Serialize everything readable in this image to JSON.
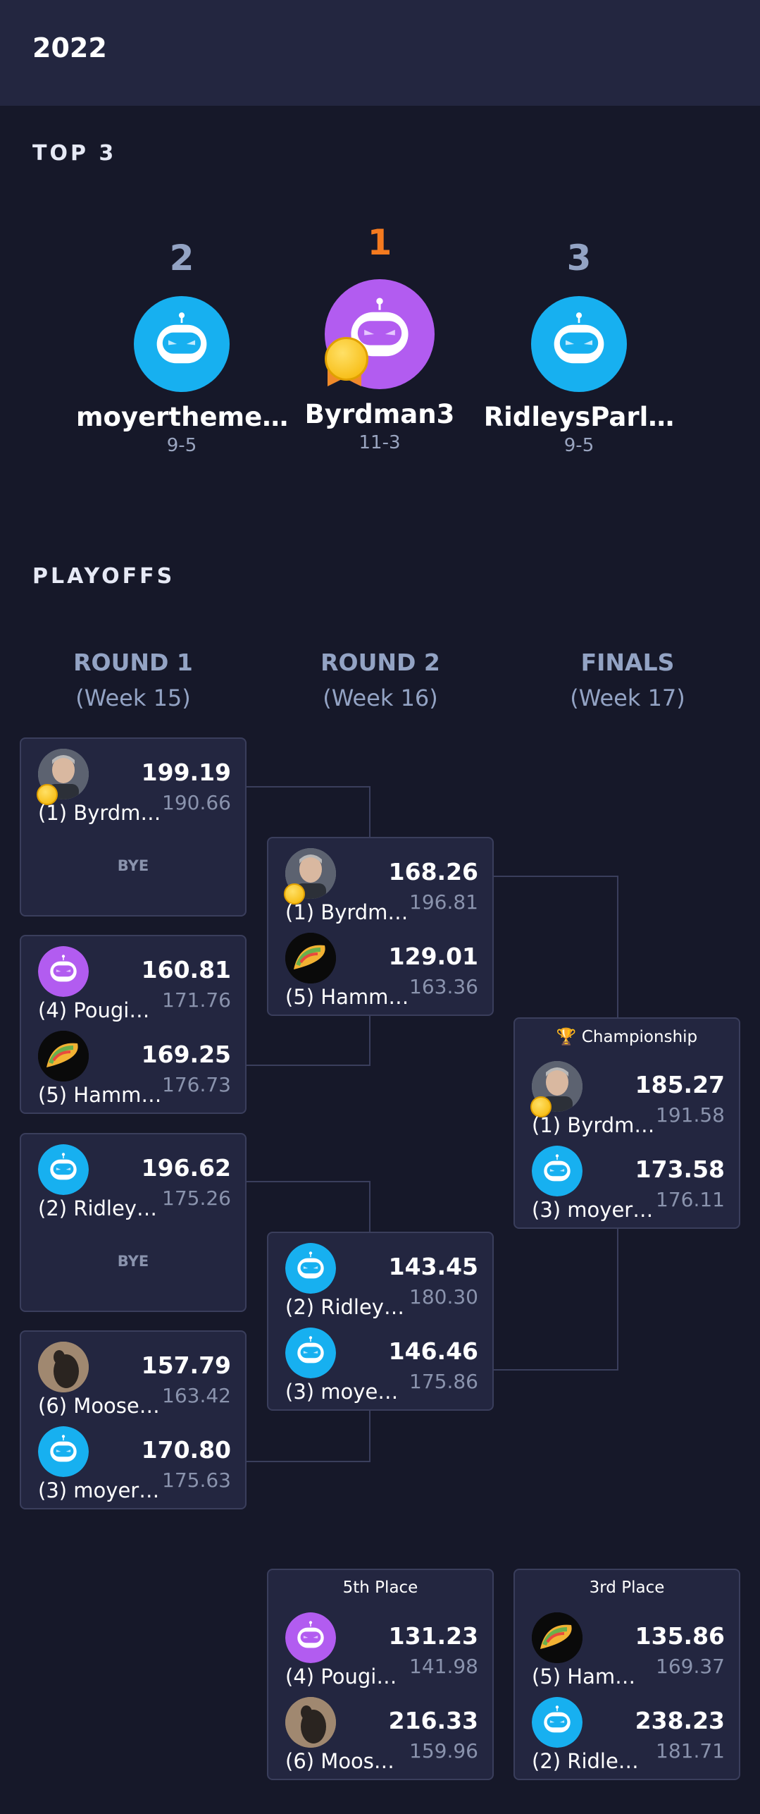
{
  "header": {
    "year": "2022"
  },
  "top3": {
    "title": "TOP 3",
    "second": {
      "rank": "2",
      "name": "moyertheme…",
      "record": "9-5"
    },
    "first": {
      "rank": "1",
      "name": "Byrdman3",
      "record": "11-3"
    },
    "third": {
      "rank": "3",
      "name": "RidleysParl…",
      "record": "9-5"
    }
  },
  "playoffs": {
    "title": "PLAYOFFS",
    "rounds": [
      {
        "title": "ROUND 1",
        "week": "(Week 15)"
      },
      {
        "title": "ROUND 2",
        "week": "(Week 16)"
      },
      {
        "title": "FINALS",
        "week": "(Week 17)"
      }
    ],
    "bye_label": "BYE",
    "r1": {
      "m1": {
        "t1": {
          "name": "(1) Byrdm…",
          "score": "199.19",
          "proj": "190.66"
        }
      },
      "m2": {
        "t1": {
          "name": "(4) Pougi…",
          "score": "160.81",
          "proj": "171.76"
        },
        "t2": {
          "name": "(5) Hamm…",
          "score": "169.25",
          "proj": "176.73"
        }
      },
      "m3": {
        "t1": {
          "name": "(2) Ridley…",
          "score": "196.62",
          "proj": "175.26"
        }
      },
      "m4": {
        "t1": {
          "name": "(6) Moose…",
          "score": "157.79",
          "proj": "163.42"
        },
        "t2": {
          "name": "(3) moyer…",
          "score": "170.80",
          "proj": "175.63"
        }
      }
    },
    "r2": {
      "m1": {
        "t1": {
          "name": "(1) Byrdm…",
          "score": "168.26",
          "proj": "196.81"
        },
        "t2": {
          "name": "(5) Hamm…",
          "score": "129.01",
          "proj": "163.36"
        }
      },
      "m2": {
        "t1": {
          "name": "(2) Ridley…",
          "score": "143.45",
          "proj": "180.30"
        },
        "t2": {
          "name": "(3) moye…",
          "score": "146.46",
          "proj": "175.86"
        }
      }
    },
    "finals": {
      "title": "🏆 Championship",
      "t1": {
        "name": "(1) Byrdm…",
        "score": "185.27",
        "proj": "191.58"
      },
      "t2": {
        "name": "(3) moyer…",
        "score": "173.58",
        "proj": "176.11"
      }
    },
    "fifth": {
      "title": "5th Place",
      "t1": {
        "name": "(4) Pougi…",
        "score": "131.23",
        "proj": "141.98"
      },
      "t2": {
        "name": "(6) Moos…",
        "score": "216.33",
        "proj": "159.96"
      }
    },
    "third_place": {
      "title": "3rd Place",
      "t1": {
        "name": "(5) Ham…",
        "score": "135.86",
        "proj": "169.37"
      },
      "t2": {
        "name": "(2) Ridle…",
        "score": "238.23",
        "proj": "181.71"
      }
    }
  },
  "colors": {
    "background": "#161829",
    "card": "#232640",
    "gold_rank": "#f47a1f",
    "robot_blue": "#17b0f0",
    "robot_purple": "#b25cf0"
  }
}
